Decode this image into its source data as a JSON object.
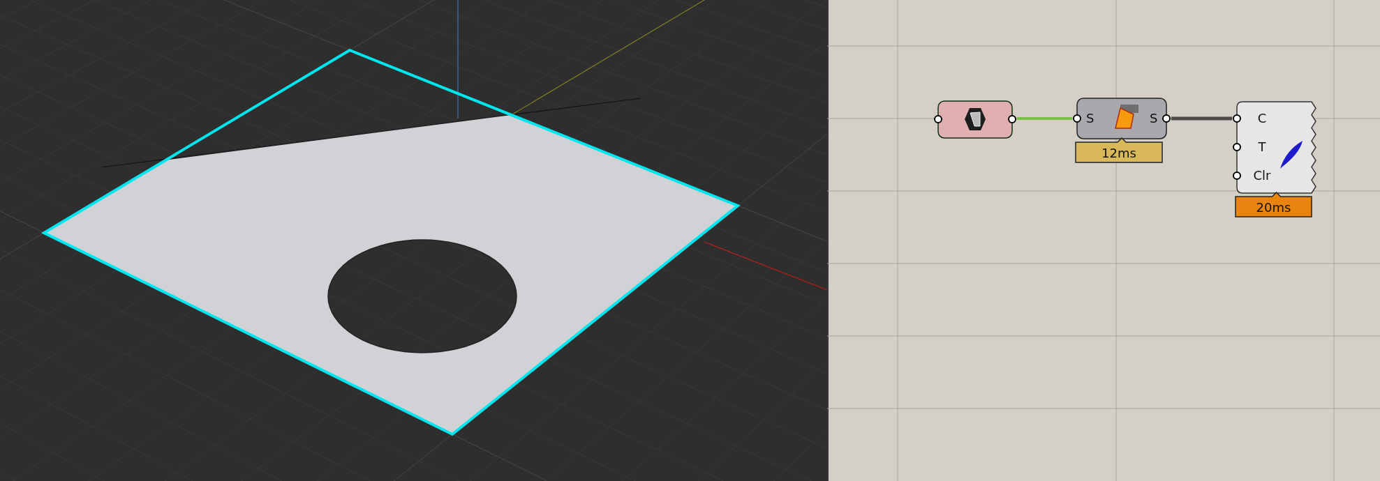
{
  "canvas": {
    "components": [
      {
        "kind": "param"
      },
      {
        "kind": "component",
        "inputs": [
          "S"
        ],
        "outputs": [
          "S"
        ],
        "timer": {
          "text": "12ms",
          "color": "#d9b85a"
        }
      },
      {
        "kind": "display",
        "inputs": [
          "C",
          "T",
          "Clr"
        ],
        "timer": {
          "text": "20ms",
          "color": "#e8850f"
        }
      }
    ]
  }
}
